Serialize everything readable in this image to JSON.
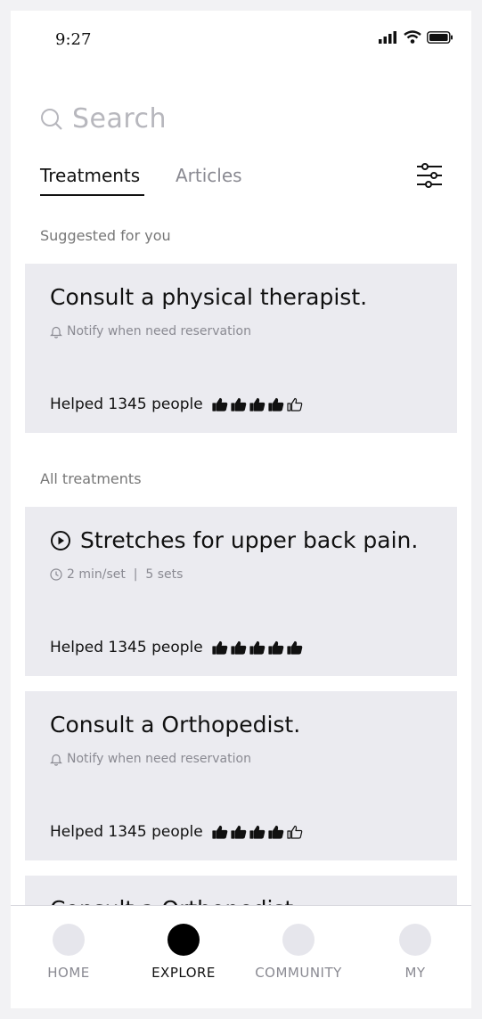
{
  "status_bar": {
    "time": "9:27"
  },
  "search": {
    "placeholder": "Search"
  },
  "tabs": [
    {
      "label": "Treatments",
      "active": true
    },
    {
      "label": "Articles",
      "active": false
    }
  ],
  "sections": {
    "suggested": "Suggested for you",
    "all": "All treatments"
  },
  "cards": [
    {
      "title": "Consult a physical therapist.",
      "subtitle": "Notify when need reservation",
      "helped": "Helped 1345 people",
      "rating": 4
    },
    {
      "title": "Stretches for upper back pain.",
      "subtitle": "2 min/set  |  5 sets",
      "helped": "Helped 1345 people",
      "rating": 5
    },
    {
      "title": "Consult a Orthopedist.",
      "subtitle": "Notify when need reservation",
      "helped": "Helped 1345 people",
      "rating": 4
    },
    {
      "title": "Consult a Orthopedist."
    }
  ],
  "nav": [
    {
      "label": "HOME",
      "active": false
    },
    {
      "label": "EXPLORE",
      "active": true
    },
    {
      "label": "COMMUNITY",
      "active": false
    },
    {
      "label": "MY",
      "active": false
    }
  ],
  "colors": {
    "card_bg": "#ebebf0",
    "accent": "#000000",
    "muted": "#8a8a92"
  }
}
